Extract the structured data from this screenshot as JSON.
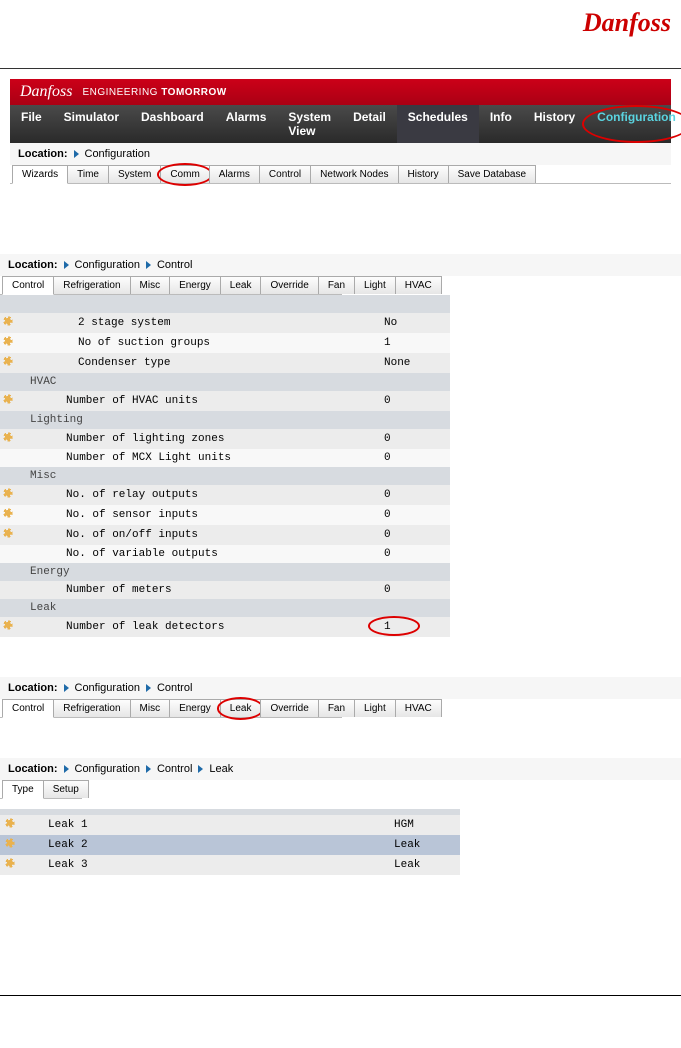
{
  "logo_text": "Danfoss",
  "banner": {
    "brand": "Danfoss",
    "tag_a": "ENGINEERING ",
    "tag_b": "TOMORROW"
  },
  "menubar": [
    "File",
    "Simulator",
    "Dashboard",
    "Alarms",
    "System View",
    "Detail",
    "Schedules",
    "Info",
    "History",
    "Configuration"
  ],
  "menubar_active": "Schedules",
  "menubar_highlight": "Configuration",
  "loc1": {
    "label": "Location:",
    "crumbs": [
      "Configuration"
    ]
  },
  "subtabs1": [
    "Wizards",
    "Time",
    "System",
    "Comm",
    "Alarms",
    "Control",
    "Network Nodes",
    "History",
    "Save Database"
  ],
  "subtabs1_active": "Wizards",
  "subtabs1_circled": "Comm",
  "loc2": {
    "label": "Location:",
    "crumbs": [
      "Configuration",
      "Control"
    ]
  },
  "subtabs2": [
    "Control",
    "Refrigeration",
    "Misc",
    "Energy",
    "Leak",
    "Override",
    "Fan",
    "Light",
    "HVAC"
  ],
  "subtabs2_active": "Control",
  "subtabs2_circled": "",
  "grid_rows": [
    {
      "type": "empty"
    },
    {
      "type": "row",
      "gear": true,
      "label": "2 stage system",
      "val": "No",
      "odd": true,
      "lev": 1
    },
    {
      "type": "row",
      "gear": true,
      "label": "No of suction groups",
      "val": "1",
      "odd": false,
      "lev": 1
    },
    {
      "type": "row",
      "gear": true,
      "label": "Condenser type",
      "val": "None",
      "odd": true,
      "lev": 1
    },
    {
      "type": "hdr",
      "label": "HVAC"
    },
    {
      "type": "row",
      "gear": true,
      "label": "Number of HVAC units",
      "val": "0",
      "odd": true,
      "lev": 0
    },
    {
      "type": "hdr",
      "label": "Lighting"
    },
    {
      "type": "row",
      "gear": true,
      "label": "Number of lighting zones",
      "val": "0",
      "odd": true,
      "lev": 0
    },
    {
      "type": "row",
      "gear": false,
      "label": "Number of MCX Light units",
      "val": "0",
      "odd": false,
      "lev": 0
    },
    {
      "type": "hdr",
      "label": "Misc"
    },
    {
      "type": "row",
      "gear": true,
      "label": "No. of relay outputs",
      "val": "0",
      "odd": true,
      "lev": 0
    },
    {
      "type": "row",
      "gear": true,
      "label": "No. of sensor inputs",
      "val": "0",
      "odd": false,
      "lev": 0
    },
    {
      "type": "row",
      "gear": true,
      "label": "No. of on/off inputs",
      "val": "0",
      "odd": true,
      "lev": 0
    },
    {
      "type": "row",
      "gear": false,
      "label": "No. of variable outputs",
      "val": "0",
      "odd": false,
      "lev": 0
    },
    {
      "type": "hdr",
      "label": "Energy"
    },
    {
      "type": "row",
      "gear": false,
      "label": "Number of meters",
      "val": "0",
      "odd": true,
      "lev": 0
    },
    {
      "type": "hdr",
      "label": "Leak"
    },
    {
      "type": "row",
      "gear": true,
      "label": "Number of leak detectors",
      "val": "1",
      "odd": true,
      "lev": 0,
      "circled": true
    }
  ],
  "loc3": {
    "label": "Location:",
    "crumbs": [
      "Configuration",
      "Control"
    ]
  },
  "subtabs3": [
    "Control",
    "Refrigeration",
    "Misc",
    "Energy",
    "Leak",
    "Override",
    "Fan",
    "Light",
    "HVAC"
  ],
  "subtabs3_active": "Control",
  "subtabs3_circled": "Leak",
  "loc4": {
    "label": "Location:",
    "crumbs": [
      "Configuration",
      "Control",
      "Leak"
    ]
  },
  "subtabs4": [
    "Type",
    "Setup"
  ],
  "subtabs4_active": "Type",
  "leak_rows": [
    {
      "gear": true,
      "name": "Leak 1",
      "val": "HGM",
      "cls": "r1"
    },
    {
      "gear": true,
      "name": "Leak 2",
      "val": "Leak",
      "cls": "r2"
    },
    {
      "gear": true,
      "name": "Leak 3",
      "val": "Leak",
      "cls": "r3"
    }
  ]
}
